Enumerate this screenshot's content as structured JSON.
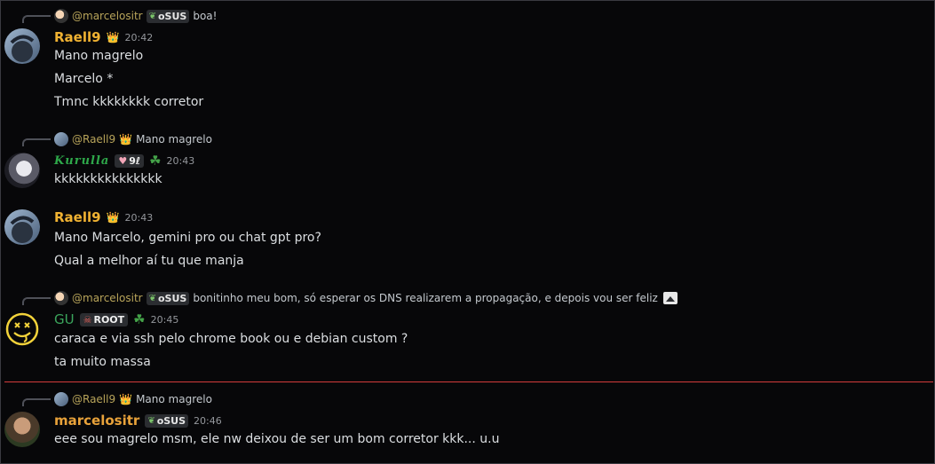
{
  "messages": {
    "m1": {
      "reply": {
        "name": "@marcelositr",
        "tag": "oSUS",
        "text": "boa!"
      },
      "author": "Raell9",
      "time": "20:42",
      "lines": [
        "Mano magrelo",
        "Marcelo *",
        "Tmnc kkkkkkkk corretor"
      ]
    },
    "m2": {
      "reply": {
        "name": "@Raell9",
        "text": "Mano magrelo"
      },
      "author": "𝑲𝒖𝒓𝒖𝒍𝒍𝒂",
      "badge": "9ℓ",
      "time": "20:43",
      "lines": [
        "kkkkkkkkkkkkkkk"
      ]
    },
    "m3": {
      "author": "Raell9",
      "time": "20:43",
      "lines": [
        "Mano Marcelo, gemini pro ou chat gpt pro?",
        "Qual a melhor aí tu que manja"
      ]
    },
    "m4": {
      "reply": {
        "name": "@marcelositr",
        "tag": "oSUS",
        "text": "bonitinho meu bom, só esperar os DNS realizarem a propagação, e depois vou ser feliz"
      },
      "author": "GU",
      "badge": "ROOT",
      "time": "20:45",
      "lines": [
        "caraca e via ssh pelo chrome book ou e debian custom ?",
        "ta muito massa"
      ]
    },
    "m5": {
      "reply": {
        "name": "@Raell9",
        "text": "Mano magrelo"
      },
      "author": "marcelositr",
      "tag": "oSUS",
      "time": "20:46",
      "lines": [
        "eee sou magrelo msm, ele nw deixou de ser um bom corretor kkk... u.u"
      ]
    }
  },
  "colors": {
    "raell": "#f0b232",
    "gu": "#3ba55c",
    "marcelo": "#e8a23a",
    "kurulla": "#2ea84a",
    "new_divider": "#d43b3b"
  },
  "icons": {
    "crown": "crown-icon",
    "leaf": "leaf-icon",
    "clover": "clover-icon",
    "image": "image-attachment-icon"
  }
}
